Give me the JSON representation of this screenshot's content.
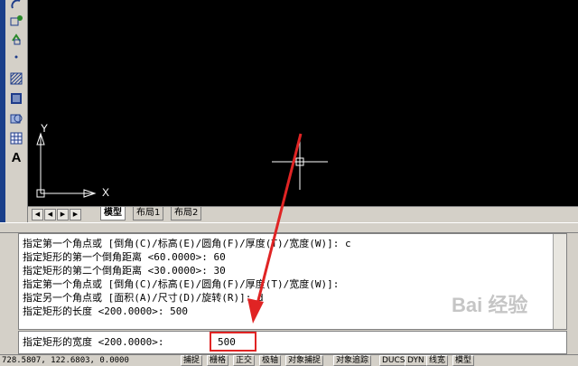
{
  "tools": [
    {
      "icon": "redo-arc-icon"
    },
    {
      "icon": "move-icon"
    },
    {
      "icon": "rotate-icon"
    },
    {
      "icon": "point-icon"
    },
    {
      "icon": "hatch-icon"
    },
    {
      "icon": "gradient-icon"
    },
    {
      "icon": "region-icon"
    },
    {
      "icon": "table-icon"
    },
    {
      "icon": "multiline-text-icon",
      "label": "A"
    }
  ],
  "canvas": {
    "axis_x": "X",
    "axis_y": "Y"
  },
  "tabs": [
    {
      "label": "模型",
      "active": true
    },
    {
      "label": "布局1",
      "active": false
    },
    {
      "label": "布局2",
      "active": false
    }
  ],
  "command_history": [
    "指定第一个角点或 [倒角(C)/标高(E)/圆角(F)/厚度(T)/宽度(W)]: c",
    "指定矩形的第一个倒角距离 <60.0000>: 60",
    "指定矩形的第二个倒角距离 <30.0000>: 30",
    "指定第一个角点或 [倒角(C)/标高(E)/圆角(F)/厚度(T)/宽度(W)]:",
    "指定另一个角点或 [面积(A)/尺寸(D)/旋转(R)]: d",
    "指定矩形的长度 <200.0000>: 500"
  ],
  "prompt": {
    "text": "指定矩形的宽度 <200.0000>:",
    "value": "500"
  },
  "status": {
    "coords": "728.5807, 122.6803, 0.0000",
    "buttons": [
      "捕捉",
      "栅格",
      "正交",
      "极轴",
      "对象捕捉",
      "对象追踪",
      "DUCS",
      "DYN",
      "线宽",
      "模型"
    ]
  },
  "watermark": "Bai 经验",
  "colors": {
    "canvas": "#000000",
    "annotation": "#e02424",
    "toolbar": "#d4d0c8",
    "crosshair": "#ffffff"
  }
}
